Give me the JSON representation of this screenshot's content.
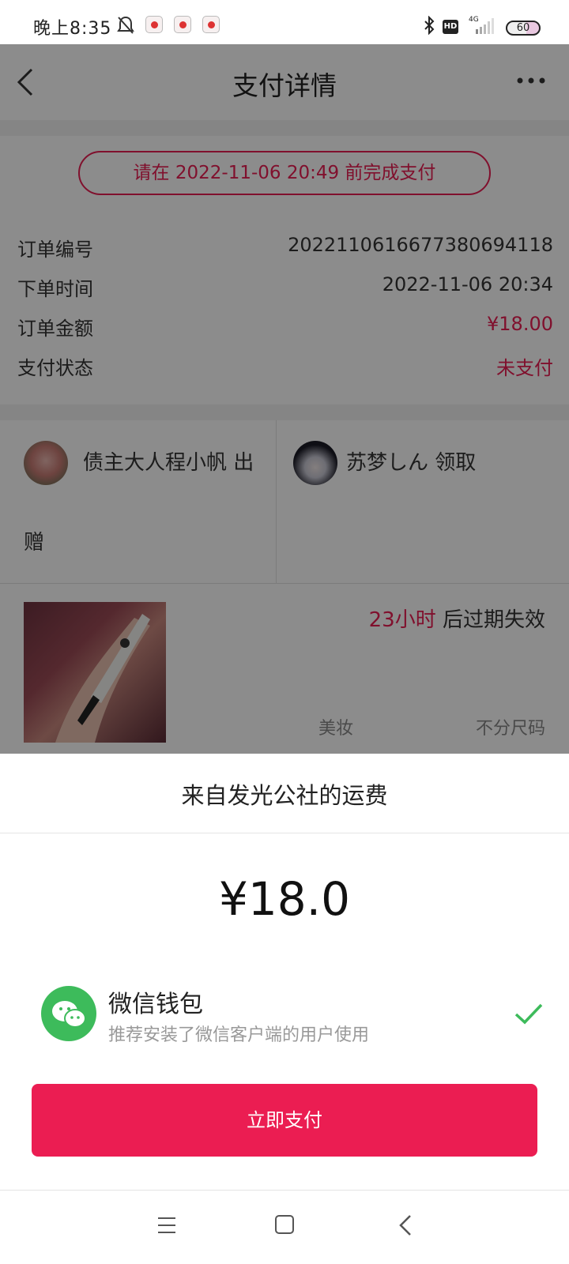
{
  "status_bar": {
    "time": "晚上8:35",
    "network": "4G",
    "hd": "HD",
    "battery": "60"
  },
  "header": {
    "title": "支付详情"
  },
  "order": {
    "deadline": "请在 2022-11-06 20:49 前完成支付",
    "rows": [
      {
        "label": "订单编号",
        "value": "20221106166773806941​18"
      },
      {
        "label": "下单时间",
        "value": "2022-11-06 20:34"
      },
      {
        "label": "订单金额",
        "value": "¥18.00"
      },
      {
        "label": "支付状态",
        "value": "未支付"
      }
    ]
  },
  "users": {
    "giver_name": "债主大人程小帆 出",
    "giver_action": "赠",
    "receiver": "苏梦しん 领取"
  },
  "product": {
    "expiry_hours": "23小时",
    "expiry_suffix": " 后过期失效",
    "category": "美妆",
    "size": "不分尺码"
  },
  "sheet": {
    "title": "来自发光公社的运费",
    "amount": "¥18.0",
    "method_name": "微信钱包",
    "method_desc": "推荐安装了微信客户端的用户使用",
    "pay_button": "立即支付"
  },
  "colors": {
    "accent": "#eb1d52",
    "wechat": "#3dbb5b"
  }
}
